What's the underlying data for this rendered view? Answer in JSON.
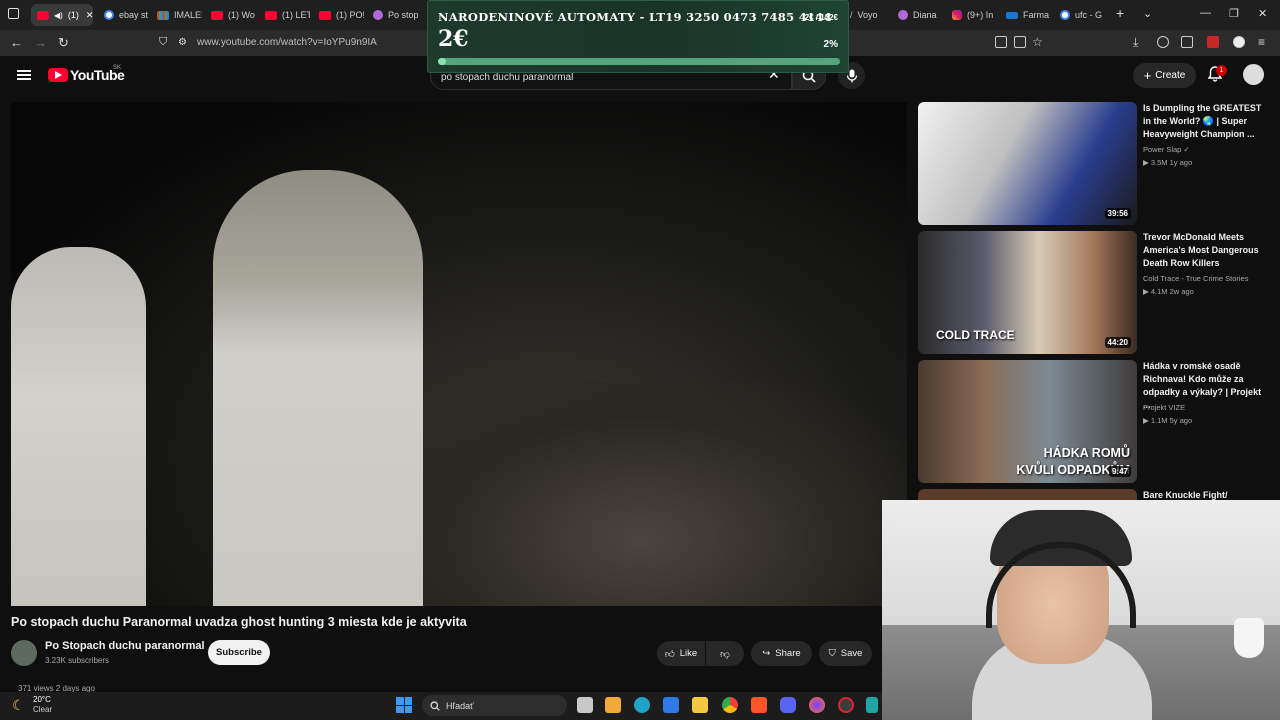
{
  "browser": {
    "tabs": [
      {
        "label": "(1)",
        "icon": "youtube-icon"
      },
      {
        "label": "ebay st",
        "icon": "google-icon"
      },
      {
        "label": "IMALE!",
        "icon": "bars-icon"
      },
      {
        "label": "(1) Wo",
        "icon": "youtube-icon"
      },
      {
        "label": "(1) LET",
        "icon": "youtube-icon"
      },
      {
        "label": "(1) PO!",
        "icon": "youtube-icon"
      },
      {
        "label": "Po stop",
        "icon": "purple-circle-icon"
      },
      {
        "label": "Voyo",
        "icon": "voyo-icon"
      },
      {
        "label": "Diana",
        "icon": "purple-circle-icon"
      },
      {
        "label": "(9+) In",
        "icon": "instagram-icon"
      },
      {
        "label": "Farma",
        "icon": "farma-icon"
      },
      {
        "label": "ufc - G",
        "icon": "google-icon"
      }
    ],
    "url": "www.youtube.com/watch?v=IoYPu9n9IA"
  },
  "donation": {
    "title": "NARODENINOVÉ AUTOMATY - LT19 3250 0473 7485 4144",
    "amount": "2€",
    "goal": "2€ / 132€",
    "percent_label": "2%",
    "progress": 0.02
  },
  "youtube": {
    "logo_text": "YouTube",
    "country": "SK",
    "search_value": "po stopach duchu paranormal",
    "create_label": "Create",
    "notification_count": "1"
  },
  "video": {
    "title": "Po stopach duchu Paranormal uvadza ghost hunting 3 miesta kde je aktyvita",
    "channel_name": "Po Stopach duchu paranormal",
    "subscribers": "3.23K subscribers",
    "subscribe_label": "Subscribe",
    "like_label": "Like",
    "share_label": "Share",
    "save_label": "Save",
    "views_line": "371 views  2 days ago"
  },
  "recommendations": [
    {
      "title": "Is Dumpling the GREATEST in the World? 🌏 | Super Heavyweight Champion ...",
      "channel": "Power Slap ✓",
      "meta": "▶ 3.5M  1y ago",
      "duration": "39:56"
    },
    {
      "title": "Trevor McDonald Meets America's Most Dangerous Death Row Killers",
      "channel": "Cold Trace - True Crime Stories",
      "meta": "▶ 4.1M  2w ago",
      "duration": "44:20",
      "caption": "COLD TRACE"
    },
    {
      "title": "Hádka v romské osadě Richnava! Kdo může za odpadky a výkaly? | Projekt ...",
      "channel": "Projekt VIZE",
      "meta": "▶ 1.1M  5y ago",
      "duration": "9:47",
      "caption": "HÁDKA ROMŮ KVŮLI ODPADKŮM"
    },
    {
      "title": "Bare Knuckle Fight/"
    }
  ],
  "taskbar": {
    "weather_temp": "20°C",
    "weather_desc": "Clear",
    "search_placeholder": "Hľadať"
  }
}
